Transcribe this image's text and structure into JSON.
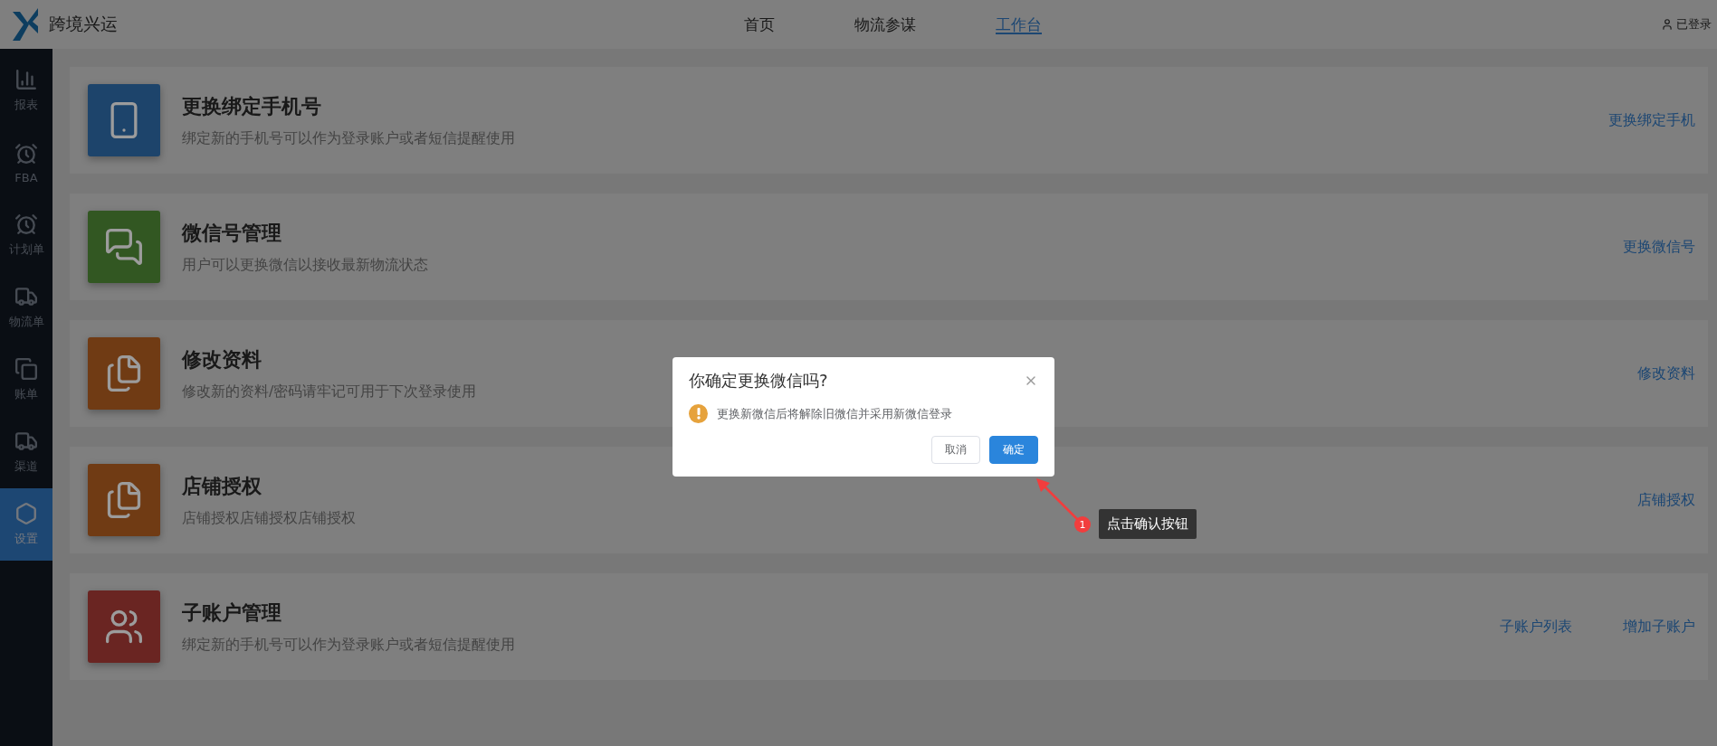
{
  "header": {
    "brand": "跨境兴运",
    "nav": [
      {
        "label": "首页",
        "selected": false
      },
      {
        "label": "物流参谋",
        "selected": false
      },
      {
        "label": "工作台",
        "selected": true
      }
    ],
    "user_label": "已登录"
  },
  "sidebar": {
    "items": [
      {
        "label": "报表",
        "kind": "chart",
        "selected": false
      },
      {
        "label": "FBA",
        "kind": "clock",
        "selected": false
      },
      {
        "label": "计划单",
        "kind": "clock",
        "selected": false
      },
      {
        "label": "物流单",
        "kind": "truck",
        "selected": false
      },
      {
        "label": "账单",
        "kind": "bill",
        "selected": false
      },
      {
        "label": "渠道",
        "kind": "truck",
        "selected": false
      },
      {
        "label": "设置",
        "kind": "settings",
        "selected": true
      }
    ]
  },
  "cards": [
    {
      "title": "更换绑定手机号",
      "description": "绑定新的手机号可以作为登录账户或者短信提醒使用",
      "kind": "phone",
      "color": "#1d446b",
      "links": [
        "更换绑定手机"
      ]
    },
    {
      "title": "微信号管理",
      "description": "用户可以更换微信以接收最新物流状态",
      "kind": "chat",
      "color": "#325722",
      "links": [
        "更换微信号"
      ]
    },
    {
      "title": "修改资料",
      "description": "修改新的资料/密码请牢记可用于下次登录使用",
      "kind": "documents",
      "color": "#703b14",
      "links": [
        "修改资料"
      ]
    },
    {
      "title": "店铺授权",
      "description": "店铺授权店铺授权店铺授权",
      "kind": "documents",
      "color": "#703b14",
      "links": [
        "店铺授权"
      ]
    },
    {
      "title": "子账户管理",
      "description": "绑定新的手机号可以作为登录账户或者短信提醒使用",
      "kind": "users",
      "color": "#6a2522",
      "links": [
        "子账户列表",
        "增加子账户"
      ]
    }
  ],
  "dialog": {
    "title": "你确定更换微信吗?",
    "message": "更换新微信后将解除旧微信并采用新微信登录",
    "buttons": [
      {
        "label": "取消",
        "kind": "default"
      },
      {
        "label": "确定",
        "kind": "primary"
      }
    ]
  },
  "annotation": {
    "number": "1",
    "text": "点击确认按钮"
  }
}
